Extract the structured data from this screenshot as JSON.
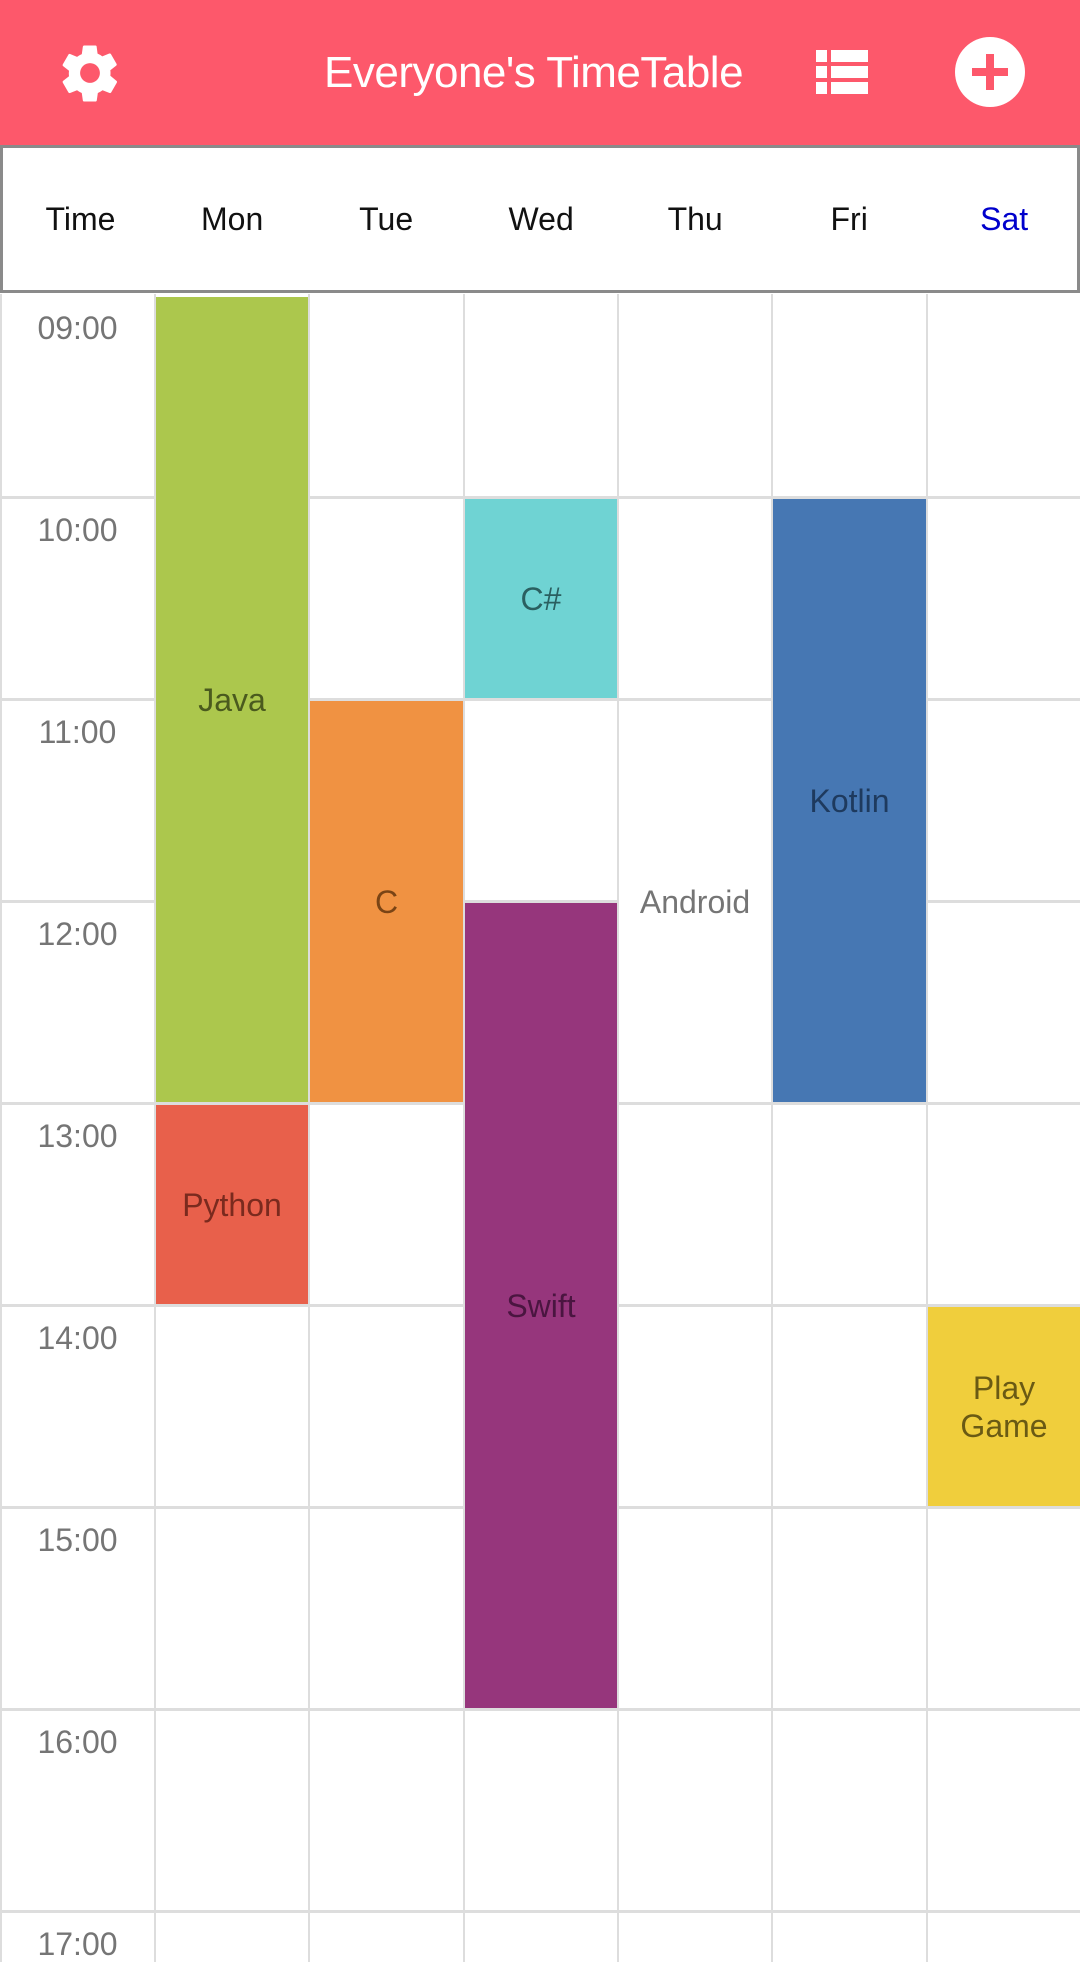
{
  "appbar": {
    "title": "Everyone's TimeTable",
    "settings_icon": "gear-icon",
    "list_icon": "list-icon",
    "add_icon": "add-circle-icon",
    "color": "#fd586b"
  },
  "days": [
    {
      "label": "Time",
      "color": "#111111"
    },
    {
      "label": "Mon",
      "color": "#111111"
    },
    {
      "label": "Tue",
      "color": "#111111"
    },
    {
      "label": "Wed",
      "color": "#111111"
    },
    {
      "label": "Thu",
      "color": "#111111"
    },
    {
      "label": "Fri",
      "color": "#111111"
    },
    {
      "label": "Sat",
      "color": "#0000cc"
    }
  ],
  "times": [
    "09:00",
    "10:00",
    "11:00",
    "12:00",
    "13:00",
    "14:00",
    "15:00",
    "16:00",
    "17:00"
  ],
  "events": [
    {
      "name": "Java",
      "day": "Mon",
      "start": "09:00",
      "end": "13:00",
      "color": "#acc74d",
      "text_color": "#4a5a1e"
    },
    {
      "name": "Python",
      "day": "Mon",
      "start": "13:00",
      "end": "14:00",
      "color": "#e8604b",
      "text_color": "#7a2a1e"
    },
    {
      "name": "C",
      "day": "Tue",
      "start": "11:00",
      "end": "13:00",
      "color": "#f09242",
      "text_color": "#7a4415"
    },
    {
      "name": "C#",
      "day": "Wed",
      "start": "10:00",
      "end": "11:00",
      "color": "#6fd3d3",
      "text_color": "#2a5f60"
    },
    {
      "name": "Swift",
      "day": "Wed",
      "start": "12:00",
      "end": "16:00",
      "color": "#96367c",
      "text_color": "#4a1540"
    },
    {
      "name": "Android",
      "day": "Thu",
      "start": "11:00",
      "end": "13:00",
      "color": "#ffffff",
      "text_color": "#757575"
    },
    {
      "name": "Kotlin",
      "day": "Fri",
      "start": "10:00",
      "end": "13:00",
      "color": "#4677b3",
      "text_color": "#1e3a5e"
    },
    {
      "name": "Play Game",
      "day": "Sat",
      "start": "14:00",
      "end": "15:00",
      "color": "#f0ce3c",
      "text_color": "#6a5a14"
    }
  ]
}
